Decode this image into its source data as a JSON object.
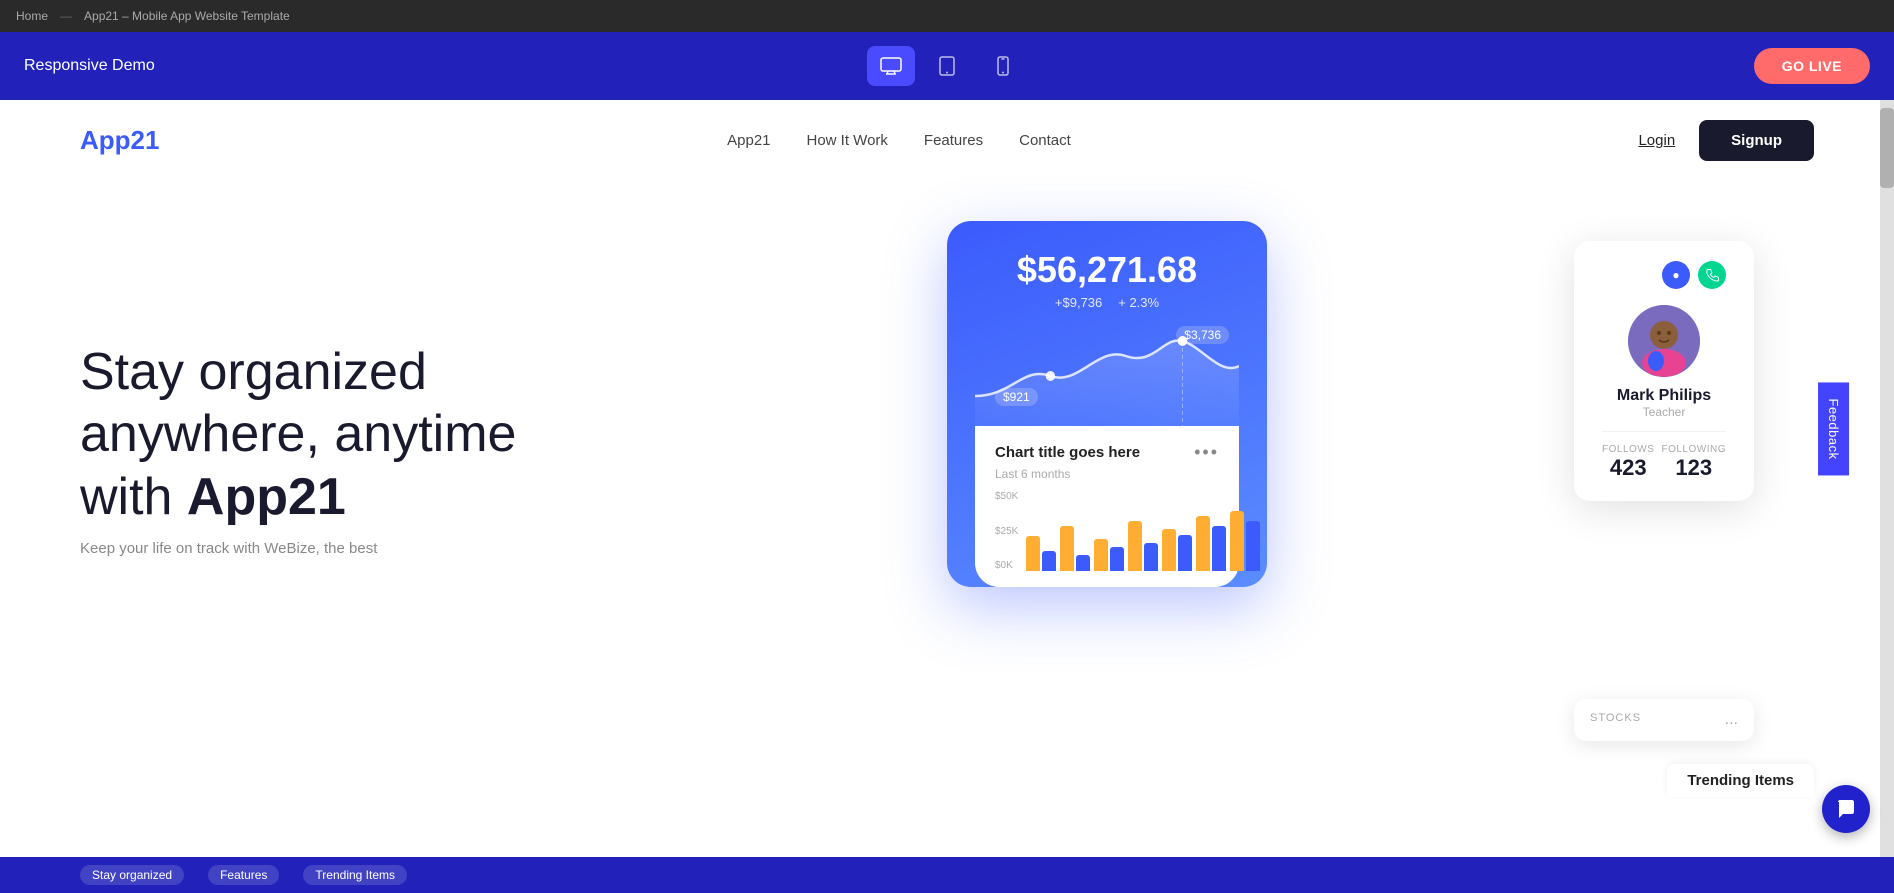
{
  "browser": {
    "home": "Home",
    "separator": "—",
    "title": "App21 – Mobile App Website Template"
  },
  "builder": {
    "logo": "Responsive Demo",
    "go_live": "GO LIVE",
    "devices": [
      {
        "name": "desktop",
        "icon": "🖥",
        "active": true
      },
      {
        "name": "tablet",
        "icon": "📱",
        "active": false
      },
      {
        "name": "mobile",
        "icon": "📱",
        "active": false
      }
    ]
  },
  "nav": {
    "logo_first": "App",
    "logo_highlight": "21",
    "links": [
      "App21",
      "How It Work",
      "Features",
      "Contact"
    ],
    "login": "Login",
    "signup": "Signup"
  },
  "hero": {
    "title_start": "Stay organized anywhere, anytime with ",
    "title_bold": "App21",
    "subtitle": "Keep your life on track with WeBize, the best"
  },
  "chart": {
    "amount": "$56,271.68",
    "stat1": "+$9,736",
    "stat2": "+ 2.3%",
    "point1": "$3,736",
    "point2": "$921",
    "title": "Chart title goes here",
    "subtitle": "Last 6 months",
    "more_dots": "...",
    "y_labels": [
      "$50K",
      "$25K",
      "$0K"
    ],
    "bar_groups": [
      {
        "orange": 45,
        "blue": 25
      },
      {
        "orange": 55,
        "blue": 20
      },
      {
        "orange": 40,
        "blue": 30
      },
      {
        "orange": 60,
        "blue": 35
      },
      {
        "orange": 50,
        "blue": 45
      },
      {
        "orange": 65,
        "blue": 55
      },
      {
        "orange": 70,
        "blue": 60
      }
    ]
  },
  "profile": {
    "name": "Mark Philips",
    "role": "Teacher",
    "follows_label": "FOLLOWS",
    "following_label": "FOLLOWING",
    "follows_count": "423",
    "following_count": "123"
  },
  "stocks": {
    "title": "STOCKS",
    "dots": "..."
  },
  "trending": {
    "label": "Trending Items"
  },
  "feedback": {
    "label": "Feedback"
  },
  "bottom": {
    "tag1": "Stay organized",
    "tag2": "Features",
    "tag3": "Trending Items"
  }
}
